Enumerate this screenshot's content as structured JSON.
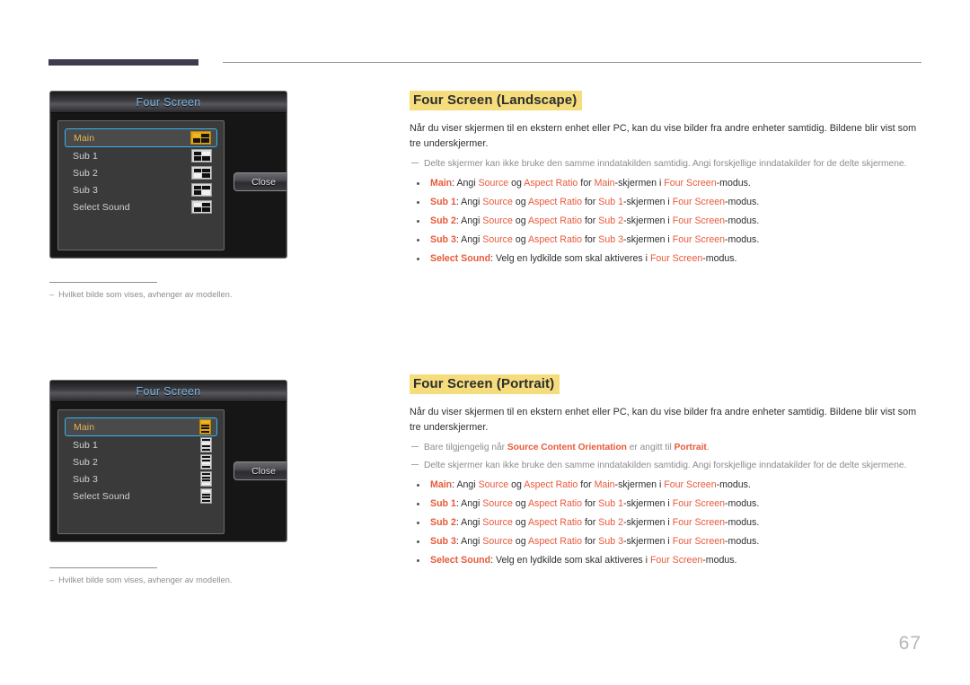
{
  "page_number": "67",
  "header": {
    "accent_color": "#413b50",
    "rule_color": "#8e8e94"
  },
  "osd_landscape": {
    "title": "Four Screen",
    "close_label": "Close",
    "items": [
      {
        "label": "Main",
        "selected": true,
        "icon": "quadrant-icon-top-left-gold",
        "highlight": 0,
        "gold": true
      },
      {
        "label": "Sub 1",
        "selected": false,
        "icon": "quadrant-icon-top-right",
        "highlight": 1,
        "gold": false
      },
      {
        "label": "Sub 2",
        "selected": false,
        "icon": "quadrant-icon-bottom-left",
        "highlight": 2,
        "gold": false
      },
      {
        "label": "Sub 3",
        "selected": false,
        "icon": "quadrant-icon-bottom-right",
        "highlight": 3,
        "gold": false
      },
      {
        "label": "Select Sound",
        "selected": false,
        "icon": "quadrant-icon-top-left",
        "highlight": 0,
        "gold": false
      }
    ],
    "footnote": {
      "dash": "–",
      "text": "Hvilket bilde som vises, avhenger av modellen."
    }
  },
  "osd_portrait": {
    "title": "Four Screen",
    "close_label": "Close",
    "items": [
      {
        "label": "Main",
        "selected": true,
        "icon": "stack-icon-row1-gold",
        "highlight": 0,
        "gold": true
      },
      {
        "label": "Sub 1",
        "selected": false,
        "icon": "stack-icon-row2",
        "highlight": 1,
        "gold": false
      },
      {
        "label": "Sub 2",
        "selected": false,
        "icon": "stack-icon-row3",
        "highlight": 2,
        "gold": false
      },
      {
        "label": "Sub 3",
        "selected": false,
        "icon": "stack-icon-row4",
        "highlight": 3,
        "gold": false
      },
      {
        "label": "Select Sound",
        "selected": false,
        "icon": "stack-icon-row1",
        "highlight": 0,
        "gold": false
      }
    ],
    "footnote": {
      "dash": "–",
      "text": "Hvilket bilde som vises, avhenger av modellen."
    }
  },
  "section_landscape": {
    "title": "Four Screen (Landscape)",
    "paragraph": "Når du viser skjermen til en ekstern enhet eller PC, kan du vise bilder fra andre enheter samtidig. Bildene blir vist som tre underskjermer.",
    "notes": [
      {
        "parts": [
          {
            "t": "Delte skjermer kan ikke bruke den samme inndatakilden samtidig. Angi forskjellige inndatakilder for de delte skjermene.",
            "hl": false
          }
        ]
      }
    ],
    "bullets": [
      {
        "term": "Main",
        "a": ": Angi ",
        "s1": "Source",
        "b": " og ",
        "s2": "Aspect Ratio",
        "c": " for ",
        "s3": "Main",
        "d": "-skjermen i ",
        "s4": "Four Screen",
        "e": "-modus."
      },
      {
        "term": "Sub 1",
        "a": ": Angi ",
        "s1": "Source",
        "b": " og ",
        "s2": "Aspect Ratio",
        "c": " for ",
        "s3": "Sub 1",
        "d": "-skjermen i ",
        "s4": "Four Screen",
        "e": "-modus."
      },
      {
        "term": "Sub 2",
        "a": ": Angi ",
        "s1": "Source",
        "b": " og ",
        "s2": "Aspect Ratio",
        "c": " for ",
        "s3": "Sub 2",
        "d": "-skjermen i ",
        "s4": "Four Screen",
        "e": "-modus."
      },
      {
        "term": "Sub 3",
        "a": ": Angi ",
        "s1": "Source",
        "b": " og ",
        "s2": "Aspect Ratio",
        "c": " for ",
        "s3": "Sub 3",
        "d": "-skjermen i ",
        "s4": "Four Screen",
        "e": "-modus."
      },
      {
        "term": "Select Sound",
        "a": ": Velg en lydkilde som skal aktiveres i ",
        "s1": "",
        "b": "",
        "s2": "",
        "c": "",
        "s3": "",
        "d": "",
        "s4": "Four Screen",
        "e": "-modus."
      }
    ]
  },
  "section_portrait": {
    "title": "Four Screen (Portrait)",
    "paragraph": "Når du viser skjermen til en ekstern enhet eller PC, kan du vise bilder fra andre enheter samtidig. Bildene blir vist som tre underskjermer.",
    "note_orientation": {
      "pre": "Bare tilgjengelig når ",
      "hl1": "Source Content Orientation",
      "mid": " er angitt til ",
      "hl2": "Portrait",
      "post": "."
    },
    "note_split": "Delte skjermer kan ikke bruke den samme inndatakilden samtidig. Angi forskjellige inndatakilder for de delte skjermene.",
    "bullets": [
      {
        "term": "Main",
        "a": ": Angi ",
        "s1": "Source",
        "b": " og ",
        "s2": "Aspect Ratio",
        "c": " for ",
        "s3": "Main",
        "d": "-skjermen i ",
        "s4": "Four Screen",
        "e": "-modus."
      },
      {
        "term": "Sub 1",
        "a": ": Angi ",
        "s1": "Source",
        "b": " og ",
        "s2": "Aspect Ratio",
        "c": " for ",
        "s3": "Sub 1",
        "d": "-skjermen i ",
        "s4": "Four Screen",
        "e": "-modus."
      },
      {
        "term": "Sub 2",
        "a": ": Angi ",
        "s1": "Source",
        "b": " og ",
        "s2": "Aspect Ratio",
        "c": " for ",
        "s3": "Sub 2",
        "d": "-skjermen i ",
        "s4": "Four Screen",
        "e": "-modus."
      },
      {
        "term": "Sub 3",
        "a": ": Angi ",
        "s1": "Source",
        "b": " og ",
        "s2": "Aspect Ratio",
        "c": " for ",
        "s3": "Sub 3",
        "d": "-skjermen i ",
        "s4": "Four Screen",
        "e": "-modus."
      },
      {
        "term": "Select Sound",
        "a": ": Velg en lydkilde som skal aktiveres i ",
        "s1": "",
        "b": "",
        "s2": "",
        "c": "",
        "s3": "",
        "d": "",
        "s4": "Four Screen",
        "e": "-modus."
      }
    ]
  },
  "colors": {
    "highlight_bg": "#f5dd7e",
    "orange": "#e8593b",
    "osd_title_text": "#7fb9e8",
    "osd_selected_text": "#e6b552",
    "osd_focus_border": "#35b4f2",
    "note_gray": "#8c8c92"
  }
}
